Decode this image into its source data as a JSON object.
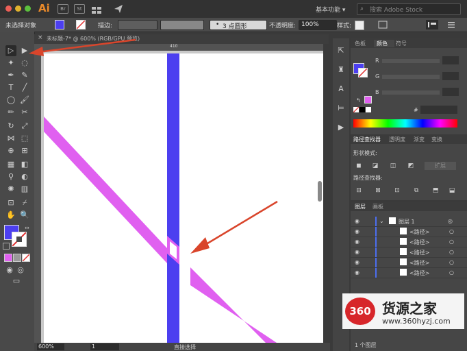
{
  "app": {
    "logo": "Ai",
    "bridge_label": "Br",
    "stock_label": "St",
    "workspace": "基本功能",
    "search_placeholder": "搜索 Adobe Stock"
  },
  "control_bar": {
    "no_selection": "未选择对象",
    "stroke_label": "描边:",
    "brush_preset": "3 点圆形",
    "opacity_label": "不透明度:",
    "opacity_value": "100%",
    "style_label": "样式:"
  },
  "document": {
    "tab_title": "未标题-7* @ 600% (RGB/GPU 预览)",
    "ruler_mark": "410"
  },
  "status_bar": {
    "zoom": "600%",
    "artboard": "1",
    "tool_status": "直接选择"
  },
  "color_panel": {
    "tabs": [
      "色板",
      "颜色",
      "符号"
    ],
    "active_tab": 1,
    "channels": [
      "R",
      "G",
      "B"
    ],
    "hex_label": "#"
  },
  "pathfinder_panel": {
    "tabs": [
      "路径查找器",
      "透明度",
      "渐变",
      "变换"
    ],
    "shape_modes_label": "形状模式:",
    "pathfinders_label": "路径查找器:",
    "expand_label": "扩展"
  },
  "layers_panel": {
    "tabs": [
      "图层",
      "画板"
    ],
    "layer_name": "图层 1",
    "items": [
      "<路径>",
      "<路径>",
      "<路径>",
      "<路径>",
      "<路径>"
    ],
    "footer": "1 个图层"
  },
  "watermark": {
    "number": "360",
    "name": "货源之家",
    "url": "www.360hyzj.com"
  },
  "colors": {
    "blue_stroke": "#4c3ff0",
    "magenta_stroke": "#e060f0",
    "arrow_red": "#d9452b",
    "ai_orange": "#e8892a"
  }
}
